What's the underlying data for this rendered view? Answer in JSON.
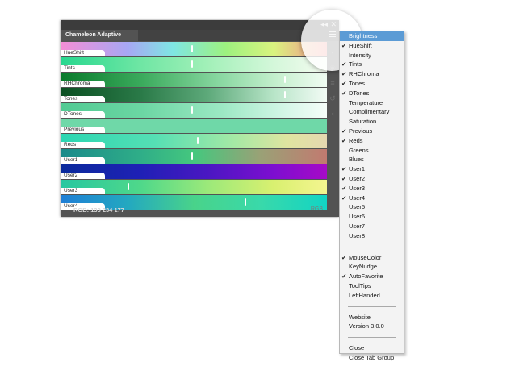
{
  "panel": {
    "tab_title": "Chameleon Adaptive Palette",
    "collapse_glyph": "◂◂",
    "close_glyph": "✕",
    "rgb_readout": "RGB: 133 234 177",
    "mode_button": "RGB",
    "rows": [
      {
        "label": "HueShift",
        "gradient": "linear-gradient(90deg,#f48ed6 0%,#a7a7f4 25%,#7fe6e3 42%,#9df17f 62%,#d9f37f 80%,#f58d8d 100%)",
        "marker": 0.49
      },
      {
        "label": "Tints",
        "gradient": "linear-gradient(90deg,#28d88f 0%,#6fe6a4 30%,#a2f0b8 55%,#d4f7da 80%,#f4fbf0 100%)",
        "marker": 0.49
      },
      {
        "label": "RHChroma",
        "gradient": "linear-gradient(90deg,#0a7a2c 0%,#3aaa5c 30%,#8ad8a2 60%,#c8f0d0 82%,#f0fcf2 100%)",
        "marker": 0.84
      },
      {
        "label": "Tones",
        "gradient": "linear-gradient(90deg,#0b4f22 0%,#2a7a48 30%,#5da97a 55%,#b8e5c8 80%,#f2fbf5 100%)",
        "marker": 0.84
      },
      {
        "label": "DTones",
        "gradient": "linear-gradient(90deg,#52ca93 0%,#6bd6a3 30%,#9be8c3 60%,#d6f7e8 85%,#f6fdf9 100%)",
        "marker": 0.49
      },
      {
        "label": "Previous",
        "gradient": "linear-gradient(90deg,#6fd8a8 0%,#6fd8a8 100%)",
        "marker": null
      },
      {
        "label": "Reds",
        "gradient": "linear-gradient(90deg,#2bd6b2 0%,#55dfb4 35%,#a5e9a5 65%,#dfe5a0 85%,#e6d8b0 100%)",
        "marker": 0.51
      },
      {
        "label": "User1",
        "gradient": "linear-gradient(90deg,#1a8a8a 0%,#2fae88 30%,#45c77e 50%,#9aa176 75%,#c27a70 100%)",
        "marker": 0.49
      },
      {
        "label": "User2",
        "gradient": "linear-gradient(90deg,#0a2a9c 0%,#1f20b6 30%,#4a17c2 55%,#7d0ed0 80%,#a60ac7 100%)",
        "marker": null
      },
      {
        "label": "User3",
        "gradient": "linear-gradient(90deg,#27c7a0 0%,#4fd88a 30%,#9be97a 55%,#d9f070 80%,#f4f590 100%)",
        "marker": 0.25
      },
      {
        "label": "User4",
        "gradient": "linear-gradient(90deg,#1f7fd6 0%,#23a8c0 25%,#49d38a 50%,#39d9aa 75%,#12d4c4 100%)",
        "marker": 0.69
      }
    ],
    "sidebar_icons": [
      "lock-icon",
      "eye-icon",
      "list-icon",
      "undo-icon",
      "drop-icon"
    ]
  },
  "menu": {
    "groups": [
      [
        {
          "label": "Brightness",
          "checked": false,
          "highlight": true
        },
        {
          "label": "HueShift",
          "checked": true
        },
        {
          "label": "Intensity",
          "checked": false
        },
        {
          "label": "Tints",
          "checked": true
        },
        {
          "label": "RHChroma",
          "checked": true
        },
        {
          "label": "Tones",
          "checked": true
        },
        {
          "label": "DTones",
          "checked": true
        },
        {
          "label": "Temperature",
          "checked": false
        },
        {
          "label": "Complimentary",
          "checked": false
        },
        {
          "label": "Saturation",
          "checked": false
        },
        {
          "label": "Previous",
          "checked": true
        },
        {
          "label": "Reds",
          "checked": true
        },
        {
          "label": "Greens",
          "checked": false
        },
        {
          "label": "Blues",
          "checked": false
        },
        {
          "label": "User1",
          "checked": true
        },
        {
          "label": "User2",
          "checked": true
        },
        {
          "label": "User3",
          "checked": true
        },
        {
          "label": "User4",
          "checked": true
        },
        {
          "label": "User5",
          "checked": false
        },
        {
          "label": "User6",
          "checked": false
        },
        {
          "label": "User7",
          "checked": false
        },
        {
          "label": "User8",
          "checked": false
        }
      ],
      [
        {
          "label": "MouseColor",
          "checked": true
        },
        {
          "label": "KeyNudge",
          "checked": false
        },
        {
          "label": "AutoFavorite",
          "checked": true
        },
        {
          "label": "ToolTips",
          "checked": false
        },
        {
          "label": "LeftHanded",
          "checked": false
        }
      ],
      [
        {
          "label": "Website",
          "checked": false
        },
        {
          "label": "Version 3.0.0",
          "checked": false
        }
      ],
      [
        {
          "label": "Close",
          "checked": false
        },
        {
          "label": "Close Tab Group",
          "checked": false
        }
      ]
    ]
  },
  "colors": {
    "highlight": "#5b9bd5",
    "panel_bg": "#535353"
  }
}
